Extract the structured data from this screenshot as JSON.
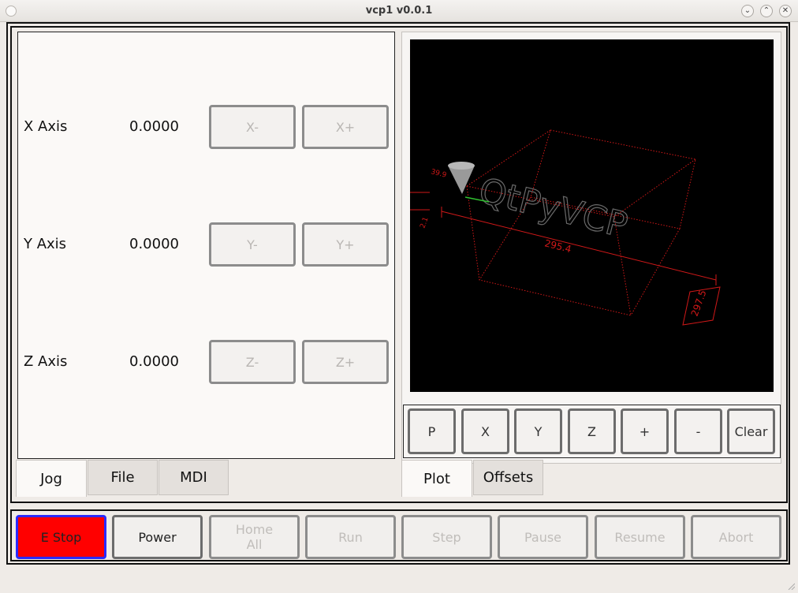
{
  "window": {
    "title": "vcp1 v0.0.1"
  },
  "jog": {
    "axes": [
      {
        "label": "X Axis",
        "value": "0.0000",
        "minus": "X-",
        "plus": "X+"
      },
      {
        "label": "Y Axis",
        "value": "0.0000",
        "minus": "Y-",
        "plus": "Y+"
      },
      {
        "label": "Z Axis",
        "value": "0.0000",
        "minus": "Z-",
        "plus": "Z+"
      }
    ]
  },
  "left_tabs": [
    "Jog",
    "File",
    "MDI"
  ],
  "right_tabs": [
    "Plot",
    "Offsets"
  ],
  "plot": {
    "view_buttons": [
      "P",
      "X",
      "Y",
      "Z",
      "+",
      "-",
      "Clear"
    ],
    "dimension_x": "295.4",
    "dimension_y": "297.5",
    "dimension_small": "39.9",
    "dimension_side": "2.1",
    "logo_text": "QtPyVCP"
  },
  "controls": [
    {
      "label": "E Stop",
      "state": "estop"
    },
    {
      "label": "Power",
      "state": "enabled"
    },
    {
      "label": "Home\nAll",
      "state": "disabled"
    },
    {
      "label": "Run",
      "state": "disabled"
    },
    {
      "label": "Step",
      "state": "disabled"
    },
    {
      "label": "Pause",
      "state": "disabled"
    },
    {
      "label": "Resume",
      "state": "disabled"
    },
    {
      "label": "Abort",
      "state": "disabled"
    }
  ],
  "colors": {
    "estop": "#ff0000",
    "plot_bg": "#000000",
    "plot_lines": "#d01818"
  }
}
